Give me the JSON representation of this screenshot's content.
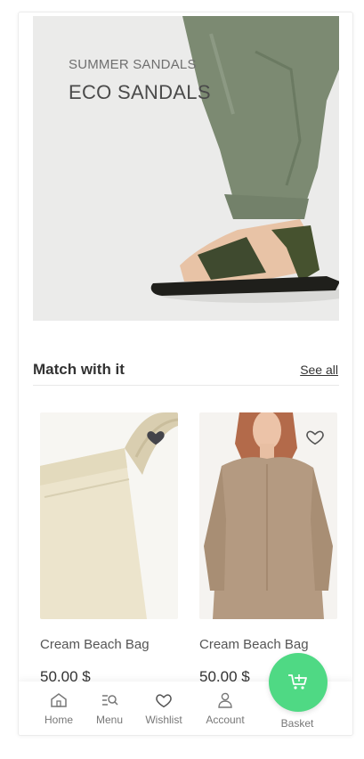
{
  "hero": {
    "subtitle": "SUMMER SANDALS",
    "title": "ECO SANDALS"
  },
  "section": {
    "title": "Match with it",
    "see_all": "See all"
  },
  "products": [
    {
      "name": "Cream Beach Bag",
      "price": "50.00 $",
      "favorited": true,
      "image": "beach-bag-photo"
    },
    {
      "name": "Cream Beach Bag",
      "price": "50.00 $",
      "favorited": false,
      "image": "knit-dress-photo"
    }
  ],
  "nav": {
    "home": "Home",
    "menu": "Menu",
    "wishlist": "Wishlist",
    "account": "Account",
    "basket": "Basket"
  },
  "colors": {
    "accent": "#4fd984",
    "text": "#333333"
  }
}
